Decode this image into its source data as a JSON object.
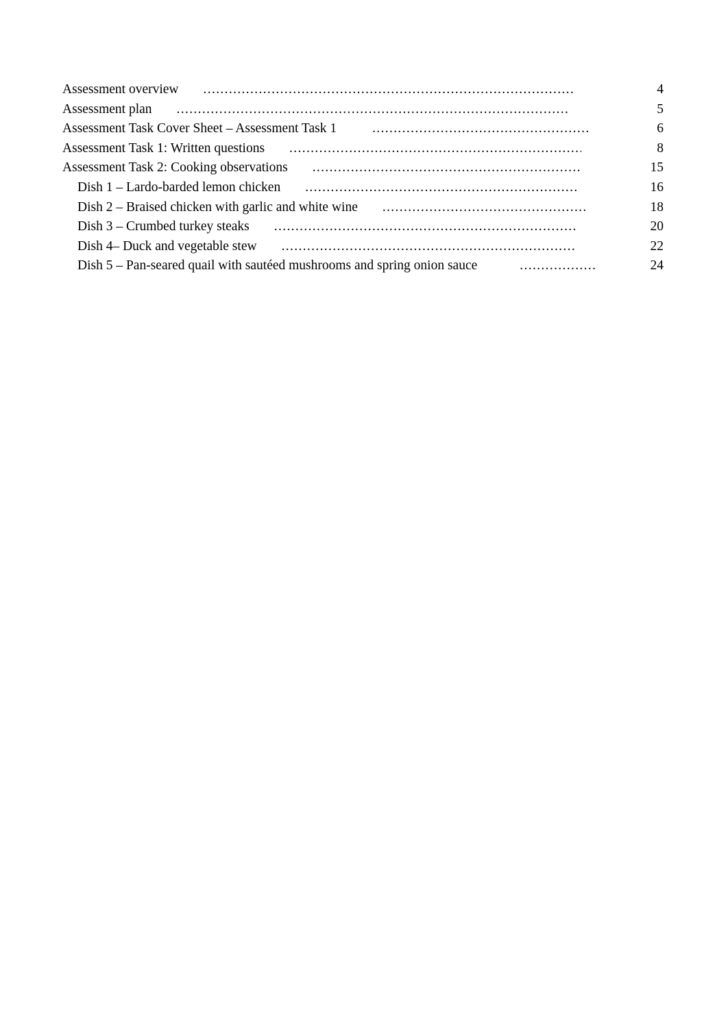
{
  "document": {
    "type": "table-of-contents",
    "background_color": "#ffffff",
    "text_color": "#000000"
  },
  "toc": {
    "leader_char": ".",
    "entries": [
      {
        "label": "Assessment overview",
        "page": "4",
        "level": 1
      },
      {
        "label": "Assessment plan",
        "page": "5",
        "level": 1
      },
      {
        "label": "Assessment Task Cover Sheet – Assessment Task 1",
        "page": "6",
        "level": 1
      },
      {
        "label": "Assessment Task 1: Written questions",
        "page": "8",
        "level": 1
      },
      {
        "label": "Assessment Task 2: Cooking observations",
        "page": "15",
        "level": 1
      },
      {
        "label": "Dish 1 – Lardo-barded lemon chicken",
        "page": "16",
        "level": 2
      },
      {
        "label": "Dish 2 – Braised chicken with garlic and white wine",
        "page": "18",
        "level": 2
      },
      {
        "label": "Dish 3 – Crumbed turkey steaks",
        "page": "20",
        "level": 2
      },
      {
        "label": "Dish 4– Duck and vegetable stew",
        "page": "22",
        "level": 2
      },
      {
        "label": "Dish 5 – Pan-seared quail with sautéed mushrooms and spring onion sauce",
        "page": "24",
        "level": 2
      }
    ]
  }
}
